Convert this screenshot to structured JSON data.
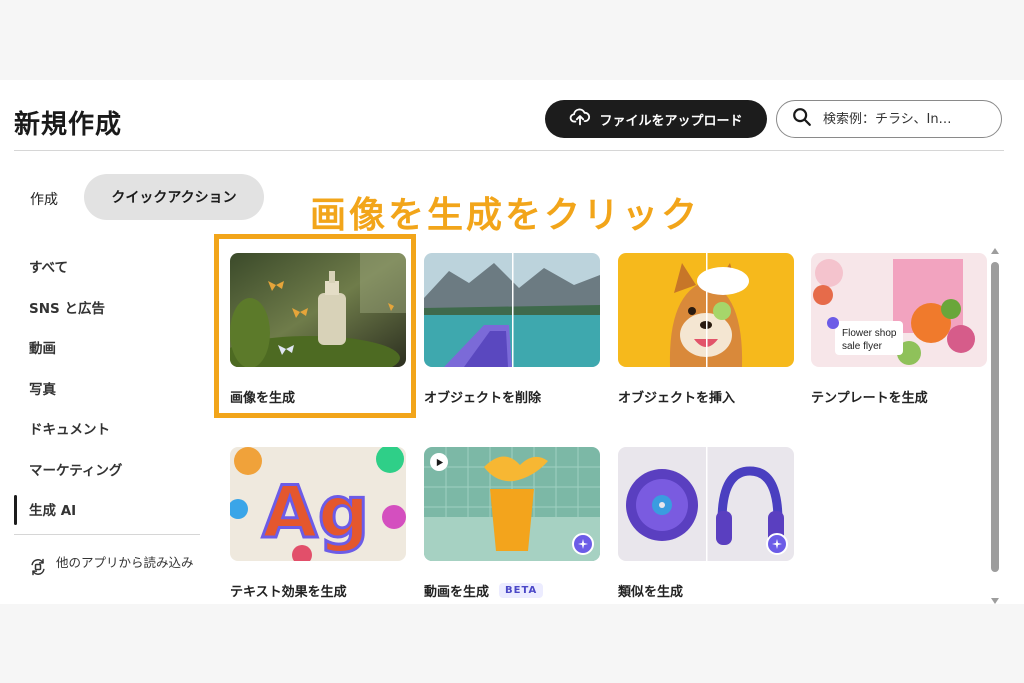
{
  "header": {
    "title": "新規作成",
    "upload_label": "ファイルをアップロード",
    "search_placeholder": "検索例：チラシ、In…"
  },
  "tabs": {
    "create": "作成",
    "quick_action": "クイックアクション"
  },
  "sidebar": {
    "items": [
      {
        "label": "すべて"
      },
      {
        "label": "SNS と広告"
      },
      {
        "label": "動画"
      },
      {
        "label": "写真"
      },
      {
        "label": "ドキュメント"
      },
      {
        "label": "マーケティング"
      },
      {
        "label": "生成 AI"
      }
    ],
    "import_label": "他のアプリから読み込み"
  },
  "callout": "画像を生成をクリック",
  "cards": [
    {
      "label": "画像を生成"
    },
    {
      "label": "オブジェクトを削除"
    },
    {
      "label": "オブジェクトを挿入"
    },
    {
      "label": "テンプレートを生成",
      "thumb_text_1": "Flower shop",
      "thumb_text_2": "sale flyer"
    },
    {
      "label": "テキスト効果を生成",
      "thumb_text": "Ag"
    },
    {
      "label": "動画を生成",
      "badge": "BETA"
    },
    {
      "label": "類似を生成"
    }
  ],
  "colors": {
    "accent_highlight": "#f2a51a",
    "dark_button": "#1c1c1c",
    "ai_badge": "#6c5ce7"
  },
  "icons": {
    "upload": "cloud-upload-icon",
    "search": "search-icon",
    "import": "import-icon",
    "ai_badge": "ai-sparkle-icon",
    "play": "play-icon"
  }
}
